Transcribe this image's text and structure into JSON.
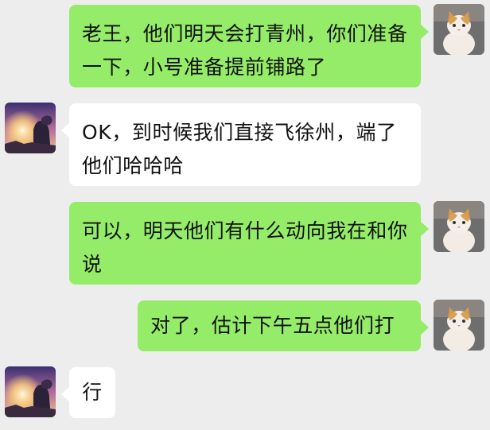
{
  "chat": {
    "messages": [
      {
        "sender": "me",
        "avatar_icon": "cat-avatar-icon",
        "text": "老王，他们明天会打青州，你们准备一下，小号准备提前铺路了"
      },
      {
        "sender": "them",
        "avatar_icon": "sunset-avatar-icon",
        "text": "OK，到时候我们直接飞徐州，端了他们哈哈哈"
      },
      {
        "sender": "me",
        "avatar_icon": "cat-avatar-icon",
        "text": "可以，明天他们有什么动向我在和你说"
      },
      {
        "sender": "me",
        "avatar_icon": "cat-avatar-icon",
        "text": "对了，估计下午五点他们打"
      },
      {
        "sender": "them",
        "avatar_icon": "sunset-avatar-icon",
        "text": "行"
      }
    ]
  },
  "colors": {
    "background": "#ededed",
    "my_bubble": "#95ec69",
    "their_bubble": "#ffffff"
  }
}
